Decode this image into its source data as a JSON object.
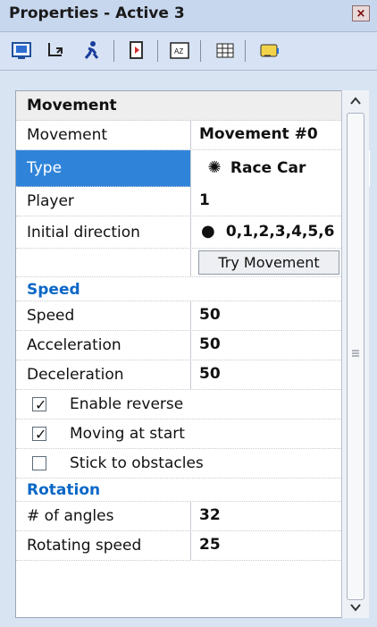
{
  "window": {
    "title": "Properties - Active 3",
    "close_label": "×"
  },
  "toolbar": {
    "icons": [
      "display-icon",
      "move-icon",
      "runner-icon",
      "document-icon",
      "az-sort-icon",
      "grid-icon",
      "note-icon"
    ]
  },
  "sections": {
    "movement": "Movement",
    "speed": "Speed",
    "rotation": "Rotation"
  },
  "properties": {
    "movement_label": "Movement",
    "movement_value": "Movement #0",
    "type_label": "Type",
    "type_value": "Race Car",
    "player_label": "Player",
    "player_value": "1",
    "initial_direction_label": "Initial direction",
    "initial_direction_value": "0,1,2,3,4,5,6",
    "try_movement_label": "Try Movement",
    "speed_label": "Speed",
    "speed_value": "50",
    "acceleration_label": "Acceleration",
    "acceleration_value": "50",
    "deceleration_label": "Deceleration",
    "deceleration_value": "50",
    "enable_reverse_label": "Enable reverse",
    "moving_at_start_label": "Moving at start",
    "stick_to_obstacles_label": "Stick to obstacles",
    "angles_label": "# of angles",
    "angles_value": "32",
    "rotating_speed_label": "Rotating speed",
    "rotating_speed_value": "25"
  },
  "checkboxes": {
    "enable_reverse": true,
    "moving_at_start": true,
    "stick_to_obstacles": false
  },
  "colors": {
    "accent": "#2f84d9",
    "section": "#0b67c7"
  }
}
